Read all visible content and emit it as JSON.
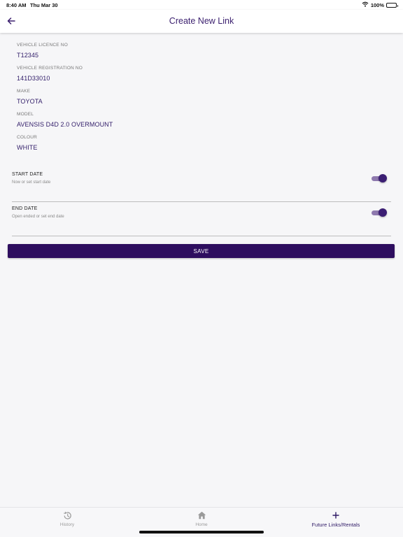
{
  "status_bar": {
    "time": "8:40 AM",
    "date": "Thu Mar 30",
    "battery": "100%",
    "icons": [
      "wifi-icon",
      "battery-icon"
    ]
  },
  "header": {
    "title": "Create New Link",
    "back_icon": "arrow-left-icon"
  },
  "vehicle": {
    "fields": [
      {
        "label": "VEHICLE LICENCE NO",
        "value": "T12345"
      },
      {
        "label": "VEHICLE REGISTRATION NO",
        "value": "141D33010"
      },
      {
        "label": "MAKE",
        "value": "TOYOTA"
      },
      {
        "label": "MODEL",
        "value": "AVENSIS D4D 2.0 OVERMOUNT"
      },
      {
        "label": "COLOUR",
        "value": "WHITE"
      }
    ]
  },
  "start_date": {
    "title": "START DATE",
    "subtitle": "Now or set start date",
    "enabled": true
  },
  "end_date": {
    "title": "END DATE",
    "subtitle": "Open ended or set end date",
    "enabled": true
  },
  "save_label": "SAVE",
  "tabs": [
    {
      "label": "History",
      "icon": "history-icon",
      "active": false
    },
    {
      "label": "Home",
      "icon": "home-icon",
      "active": false
    },
    {
      "label": "Future Links/Rentals",
      "icon": "plus-icon",
      "active": true
    }
  ],
  "colors": {
    "accent": "#2e0e5f",
    "title_text": "#3a1e6e",
    "value_text": "#34206b",
    "toggle_track": "#8e79ae",
    "background": "#f6f6f8"
  }
}
